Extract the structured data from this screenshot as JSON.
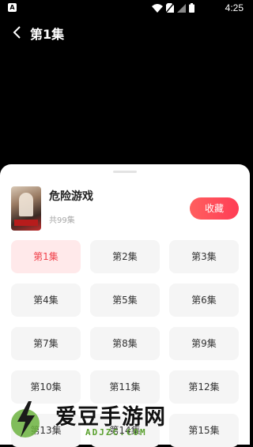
{
  "status_bar": {
    "time": "4:25",
    "app_icon_glyph": "A"
  },
  "header": {
    "title": "第1集"
  },
  "book": {
    "title": "危险游戏",
    "episode_count": "共99集",
    "favorite_label": "收藏"
  },
  "episodes": [
    {
      "label": "第1集",
      "active": true
    },
    {
      "label": "第2集"
    },
    {
      "label": "第3集"
    },
    {
      "label": "第4集"
    },
    {
      "label": "第5集"
    },
    {
      "label": "第6集"
    },
    {
      "label": "第7集"
    },
    {
      "label": "第8集"
    },
    {
      "label": "第9集"
    },
    {
      "label": "第10集"
    },
    {
      "label": "第11集"
    },
    {
      "label": "第12集"
    },
    {
      "label": "第13集"
    },
    {
      "label": "第14集"
    },
    {
      "label": "第15集"
    }
  ],
  "watermark": {
    "name": "爱豆手游网",
    "domain": "ADJZC.COM"
  },
  "colors": {
    "accent": "#f0414b",
    "button_gradient_start": "#ff5f5f",
    "button_gradient_end": "#ff3d55",
    "active_bg": "#ffe9ea"
  }
}
